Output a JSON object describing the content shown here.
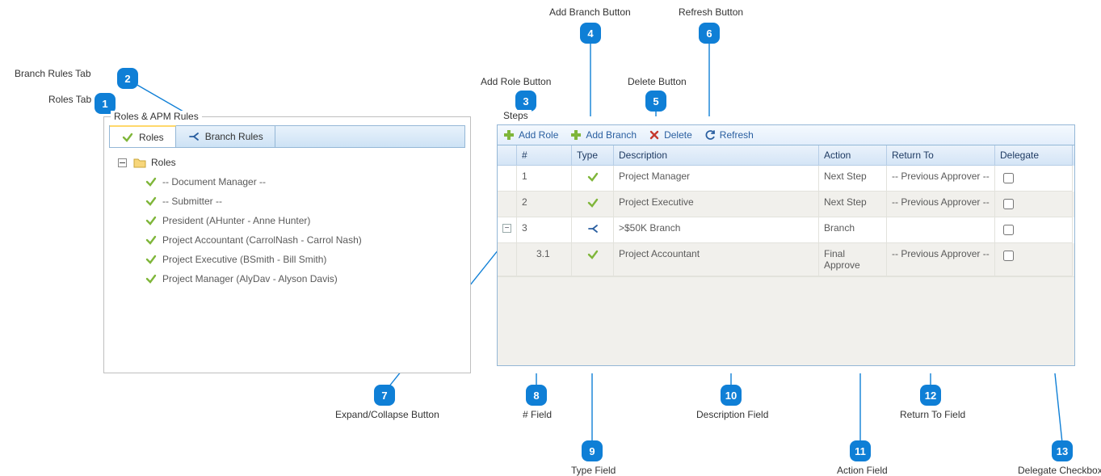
{
  "callouts": {
    "c1": {
      "num": "1",
      "label": "Roles Tab"
    },
    "c2": {
      "num": "2",
      "label": "Branch Rules Tab"
    },
    "c3": {
      "num": "3",
      "label": "Add Role Button"
    },
    "c4": {
      "num": "4",
      "label": "Add Branch Button"
    },
    "c5": {
      "num": "5",
      "label": "Delete Button"
    },
    "c6": {
      "num": "6",
      "label": "Refresh Button"
    },
    "c7": {
      "num": "7",
      "label": "Expand/Collapse Button"
    },
    "c8": {
      "num": "8",
      "label": "# Field"
    },
    "c9": {
      "num": "9",
      "label": "Type Field"
    },
    "c10": {
      "num": "10",
      "label": "Description Field"
    },
    "c11": {
      "num": "11",
      "label": "Action Field"
    },
    "c12": {
      "num": "12",
      "label": "Return To Field"
    },
    "c13": {
      "num": "13",
      "label": "Delegate Checkbox"
    }
  },
  "leftPanel": {
    "title": "Roles & APM Rules",
    "tabs": {
      "roles": "Roles",
      "branchRules": "Branch Rules"
    },
    "tree": {
      "root": "Roles",
      "items": [
        "-- Document Manager --",
        "-- Submitter --",
        "President (AHunter - Anne Hunter)",
        "Project Accountant (CarrolNash - Carrol Nash)",
        "Project Executive (BSmith - Bill Smith)",
        "Project Manager (AlyDav - Alyson Davis)"
      ]
    }
  },
  "rightPanel": {
    "title": "Steps",
    "toolbar": {
      "addRole": "Add Role",
      "addBranch": "Add Branch",
      "delete": "Delete",
      "refresh": "Refresh"
    },
    "columns": {
      "num": "#",
      "type": "Type",
      "desc": "Description",
      "action": "Action",
      "returnTo": "Return To",
      "delegate": "Delegate"
    },
    "rows": [
      {
        "expander": "",
        "num": "1",
        "type": "check",
        "desc": "Project Manager",
        "action": "Next Step",
        "returnTo": "-- Previous Approver --",
        "delegate": false,
        "sub": false
      },
      {
        "expander": "",
        "num": "2",
        "type": "check",
        "desc": "Project Executive",
        "action": "Next Step",
        "returnTo": "-- Previous Approver --",
        "delegate": false,
        "sub": false
      },
      {
        "expander": "minus",
        "num": "3",
        "type": "branch",
        "desc": ">$50K Branch",
        "action": "Branch",
        "returnTo": "",
        "delegate": false,
        "sub": false
      },
      {
        "expander": "",
        "num": "3.1",
        "type": "check",
        "desc": "Project Accountant",
        "action": "Final Approve",
        "returnTo": "-- Previous Approver --",
        "delegate": false,
        "sub": true
      }
    ]
  }
}
